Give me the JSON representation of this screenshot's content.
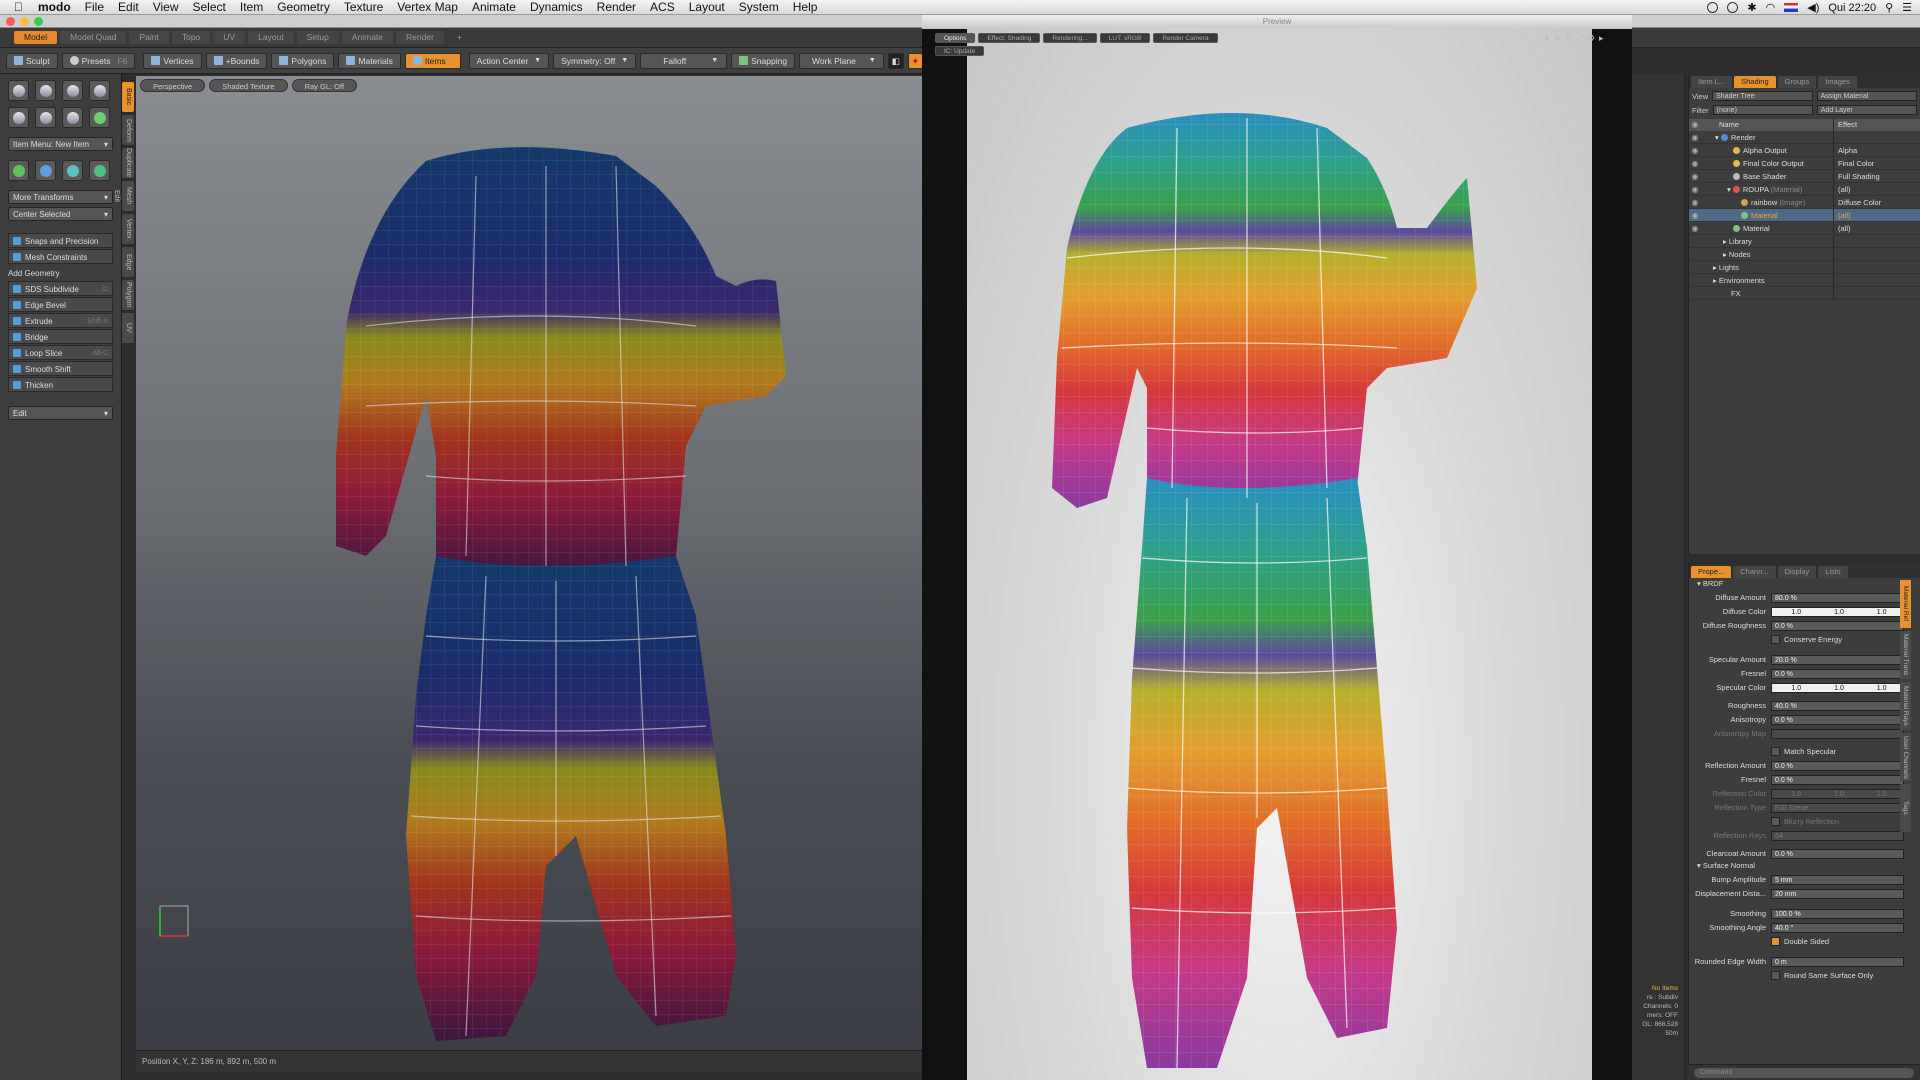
{
  "menubar": {
    "app": "modo",
    "items": [
      "File",
      "Edit",
      "View",
      "Select",
      "Item",
      "Geometry",
      "Texture",
      "Vertex Map",
      "Animate",
      "Dynamics",
      "Render",
      "ACS",
      "Layout",
      "System",
      "Help"
    ],
    "clock": "Qui 22:20"
  },
  "layout_tabs": [
    "Model",
    "Model Quad",
    "Paint",
    "Topo",
    "UV",
    "Layout",
    "Setup",
    "Animate",
    "Render",
    "+"
  ],
  "toolbar": {
    "sculpt": "Sculpt",
    "presets": "Presets",
    "presets_key": "F6",
    "vertices": "Vertices",
    "bounds": "+Bounds",
    "polygons": "Polygons",
    "materials": "Materials",
    "items": "Items",
    "action_center": "Action Center",
    "symmetry": "Symmetry: Off",
    "falloff": "Falloff",
    "snapping": "Snapping",
    "work_plane": "Work Plane"
  },
  "toolbox": {
    "item_menu": "Item Menu: New Item",
    "more_transforms": "More Transforms",
    "center_selected": "Center Selected",
    "snaps": "Snaps and Precision",
    "mesh_constraints": "Mesh Constraints",
    "add_geometry": "Add Geometry",
    "tools": [
      {
        "label": "SDS Subdivide",
        "key": "D"
      },
      {
        "label": "Edge Bevel",
        "key": ""
      },
      {
        "label": "Extrude",
        "key": "Shift-X"
      },
      {
        "label": "Bridge",
        "key": ""
      },
      {
        "label": "Loop Slice",
        "key": "Alt-C"
      },
      {
        "label": "Smooth Shift",
        "key": ""
      },
      {
        "label": "Thicken",
        "key": ""
      }
    ],
    "edit": "Edit"
  },
  "vtabs": [
    "Basic",
    "Deform",
    "Duplicate",
    "Mesh Edit",
    "Vertex",
    "Edge",
    "Polygon",
    "UV"
  ],
  "viewport": {
    "tabs": [
      "Perspective",
      "Shaded Texture",
      "Ray GL: Off"
    ],
    "status": "Position X, Y, Z:   186 m, 892 m, 500 m"
  },
  "preview": {
    "title": "Preview",
    "tabs": [
      "Options",
      "Effect: Shading",
      "Rendering...",
      "LUT: sRGB",
      "Render Camera",
      "IC: Update"
    ]
  },
  "shading": {
    "tabs": [
      "Item L...",
      "Shading",
      "Groups",
      "Images"
    ],
    "view_label": "View",
    "view_value": "Shader Tree",
    "assign": "Assign Material",
    "filter_label": "Filter",
    "filter_value": "(none)",
    "add_layer": "Add Layer",
    "col_name": "Name",
    "col_effect": "Effect",
    "rows": [
      {
        "name": "Render",
        "effect": "",
        "indent": 0,
        "color": "#4d8fd6"
      },
      {
        "name": "Alpha Output",
        "effect": "Alpha",
        "indent": 2,
        "color": "#e6b84a"
      },
      {
        "name": "Final Color Output",
        "effect": "Final Color",
        "indent": 2,
        "color": "#e6b84a"
      },
      {
        "name": "Base Shader",
        "effect": "Full Shading",
        "indent": 2,
        "color": "#bbbbbb"
      },
      {
        "name": "ROUPA",
        "effect": "(all)",
        "indent": 2,
        "color": "#d65a4d",
        "tag": "(Material)"
      },
      {
        "name": "rainbow",
        "effect": "Diffuse Color",
        "indent": 3,
        "color": "#d6a34d",
        "tag": "(Image)"
      },
      {
        "name": "Material",
        "effect": "(all)",
        "indent": 3,
        "color": "#7fc27f",
        "sel": true
      },
      {
        "name": "Material",
        "effect": "(all)",
        "indent": 2,
        "color": "#7fc27f"
      },
      {
        "name": "Library",
        "effect": "",
        "indent": 1,
        "color": ""
      },
      {
        "name": "Nodes",
        "effect": "",
        "indent": 1,
        "color": ""
      },
      {
        "name": "Lights",
        "effect": "",
        "indent": 0,
        "color": ""
      },
      {
        "name": "Environments",
        "effect": "",
        "indent": 0,
        "color": ""
      },
      {
        "name": "FX",
        "effect": "",
        "indent": 1,
        "color": ""
      }
    ]
  },
  "props": {
    "tabs": [
      "Prope...",
      "Chann...",
      "Display",
      "Lists"
    ],
    "brdf": "BRDF",
    "diffuse_amount": {
      "label": "Diffuse Amount",
      "value": "80.0 %"
    },
    "diffuse_color": {
      "label": "Diffuse Color",
      "value": [
        "1.0",
        "1.0",
        "1.0"
      ]
    },
    "diffuse_roughness": {
      "label": "Diffuse Roughness",
      "value": "0.0 %"
    },
    "conserve_energy": "Conserve Energy",
    "specular_amount": {
      "label": "Specular Amount",
      "value": "20.0 %"
    },
    "fresnel1": {
      "label": "Fresnel",
      "value": "0.0 %"
    },
    "specular_color": {
      "label": "Specular Color",
      "value": [
        "1.0",
        "1.0",
        "1.0"
      ]
    },
    "roughness": {
      "label": "Roughness",
      "value": "40.0 %"
    },
    "anisotropy": {
      "label": "Anisotropy",
      "value": "0.0 %"
    },
    "anisotropy_map": {
      "label": "Anisotropy Map",
      "value": ""
    },
    "match_specular": "Match Specular",
    "reflection_amount": {
      "label": "Reflection Amount",
      "value": "0.0 %"
    },
    "fresnel2": {
      "label": "Fresnel",
      "value": "0.0 %"
    },
    "reflection_color": {
      "label": "Reflection Color",
      "value": [
        "1.0",
        "1.0",
        "1.0"
      ]
    },
    "reflection_type": {
      "label": "Reflection Type",
      "value": "Full Scene"
    },
    "blurry": "Blurry Reflection",
    "reflection_rays": {
      "label": "Reflection Rays",
      "value": "64"
    },
    "clearcoat": {
      "label": "Clearcoat Amount",
      "value": "0.0 %"
    },
    "surface_normal": "Surface Normal",
    "bump": {
      "label": "Bump Amplitude",
      "value": "5 mm"
    },
    "displacement": {
      "label": "Displacement Dista...",
      "value": "20 mm"
    },
    "smoothing": {
      "label": "Smoothing",
      "value": "100.0 %"
    },
    "smoothing_angle": {
      "label": "Smoothing Angle",
      "value": "40.0 °"
    },
    "double_sided": "Double Sided",
    "rounded_edge": {
      "label": "Rounded Edge Width",
      "value": "0 m"
    },
    "round_same": "Round Same Surface Only",
    "side_tabs": [
      "Material Ref",
      "Material Trans",
      "Material Rays",
      "User Channels",
      "Tags"
    ]
  },
  "stats": [
    "No Items",
    "re : Subdiv",
    "Channels: 0",
    "mers: OFF",
    "GL: 868,528",
    "50m"
  ],
  "command": "Command",
  "colors": {
    "accent": "#e8922e"
  }
}
